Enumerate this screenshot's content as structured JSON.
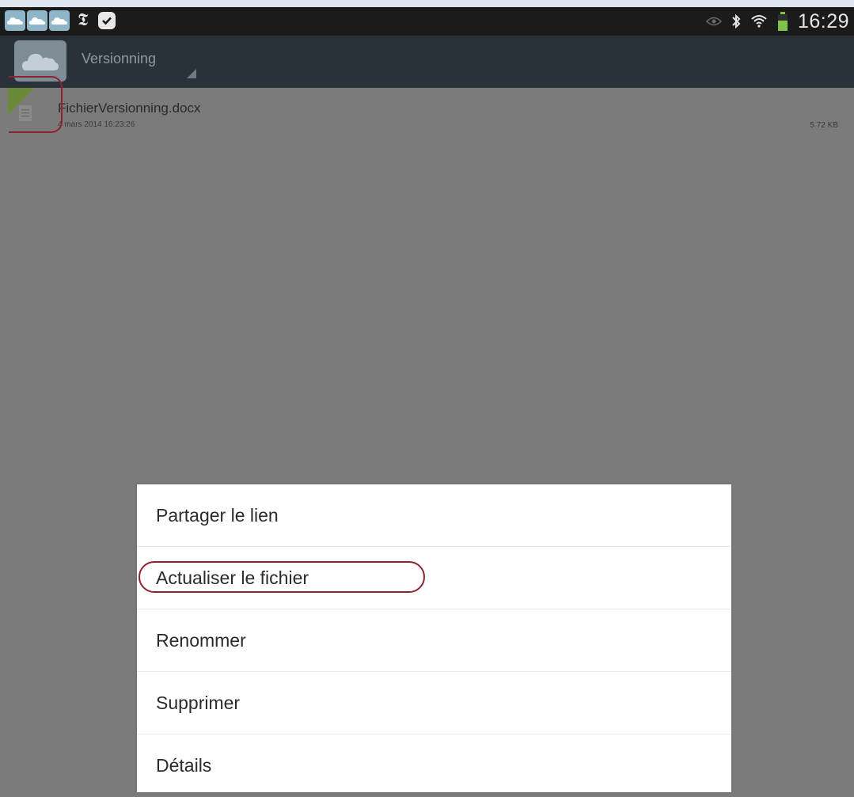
{
  "status_bar": {
    "time": "16:29",
    "notification_icons": [
      "cloud-icon",
      "cloud-icon",
      "cloud-icon",
      "newspaper-icon",
      "check-icon"
    ],
    "system_icons": [
      "eye-icon",
      "bluetooth-icon",
      "wifi-icon",
      "battery-icon"
    ]
  },
  "action_bar": {
    "app_icon": "cloud-icon",
    "title": "Versionning"
  },
  "file": {
    "name": "FichierVersionning.docx",
    "date": "4 mars 2014 16:23:26",
    "size": "5.72 KB"
  },
  "context_menu": {
    "items": [
      {
        "label": "Partager le lien"
      },
      {
        "label": "Actualiser le fichier"
      },
      {
        "label": "Renommer"
      },
      {
        "label": "Supprimer"
      },
      {
        "label": "Détails"
      }
    ]
  },
  "colors": {
    "dim_overlay": "#7b7b7b",
    "action_bar": "#2a3239",
    "annotation": "#8e2233",
    "menu_bg": "#ffffff"
  }
}
